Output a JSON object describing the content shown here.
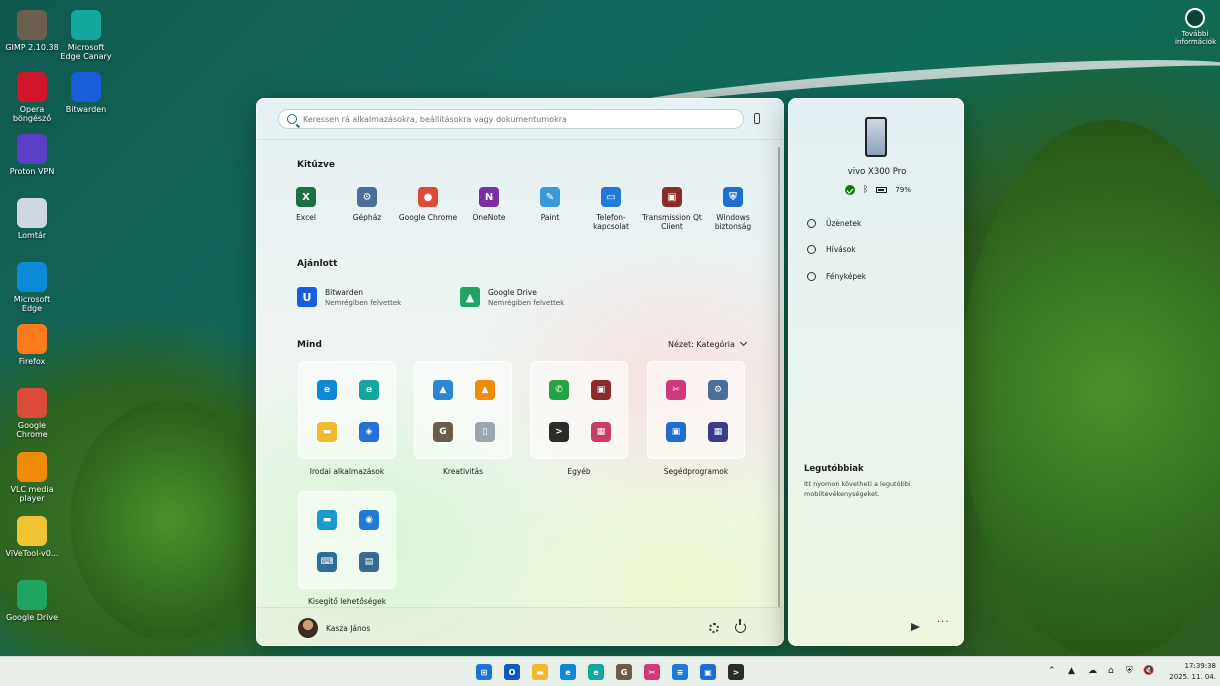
{
  "desktop": {
    "icons": [
      {
        "label": "GIMP 2.10.38",
        "name": "gimp-icon"
      },
      {
        "label": "Microsoft Edge Canary",
        "name": "edge-canary-icon"
      },
      {
        "label": "Opera böngésző",
        "name": "opera-icon"
      },
      {
        "label": "Bitwarden",
        "name": "bitwarden-icon"
      },
      {
        "label": "Proton VPN",
        "name": "proton-vpn-icon"
      },
      {
        "label": "Lomtár",
        "name": "recycle-bin-icon"
      },
      {
        "label": "Microsoft Edge",
        "name": "edge-icon"
      },
      {
        "label": "Firefox",
        "name": "firefox-icon"
      },
      {
        "label": "Google Chrome",
        "name": "chrome-icon"
      },
      {
        "label": "VLC media player",
        "name": "vlc-icon"
      },
      {
        "label": "ViVeTool-v0...",
        "name": "folder-icon"
      },
      {
        "label": "Google Drive",
        "name": "google-drive-icon"
      }
    ],
    "info": "További információk"
  },
  "start": {
    "search_placeholder": "Keressen rá alkalmazásokra, beállításokra vagy dokumentumokra",
    "pinned_title": "Kitűzve",
    "pinned": [
      {
        "label": "Excel",
        "name": "excel-icon",
        "color": "#1d7044",
        "glyph": "X"
      },
      {
        "label": "Gépház",
        "name": "settings-icon",
        "color": "#4a6f9a",
        "glyph": "⚙"
      },
      {
        "label": "Google Chrome",
        "name": "chrome-icon",
        "color": "#dd4b39",
        "glyph": "●"
      },
      {
        "label": "OneNote",
        "name": "onenote-icon",
        "color": "#7b2fa6",
        "glyph": "N"
      },
      {
        "label": "Paint",
        "name": "paint-icon",
        "color": "#3a9ad9",
        "glyph": "✎"
      },
      {
        "label": "Telefon-kapcsolat",
        "name": "phone-link-icon",
        "color": "#1f7ad8",
        "glyph": "▭"
      },
      {
        "label": "Transmission Qt Client",
        "name": "transmission-icon",
        "color": "#8b2b2b",
        "glyph": "▣"
      },
      {
        "label": "Windows biztonság",
        "name": "windows-security-icon",
        "color": "#1f6fd1",
        "glyph": "⛨"
      }
    ],
    "recommended_title": "Ajánlott",
    "recommended": [
      {
        "title": "Bitwarden",
        "subtitle": "Nemrégiben felvettek",
        "name": "bitwarden-icon",
        "color": "#175ddc",
        "glyph": "U"
      },
      {
        "title": "Google Drive",
        "subtitle": "Nemrégiben felvettek",
        "name": "google-drive-icon",
        "color": "#1fa463",
        "glyph": "▲"
      }
    ],
    "all_title": "Mind",
    "view_label": "Nézet: Kategória",
    "categories": [
      {
        "label": "Irodai alkalmazások",
        "apps": [
          {
            "name": "edge-icon",
            "color": "#0c8ad8",
            "glyph": "e"
          },
          {
            "name": "edge-canary-icon",
            "color": "#13a89e",
            "glyph": "e"
          },
          {
            "name": "file-explorer-icon",
            "color": "#f1b92e",
            "glyph": "▬"
          },
          {
            "name": "office-icon",
            "color": "#2a6fd6",
            "glyph": "◈"
          }
        ]
      },
      {
        "label": "Kreativitás",
        "apps": [
          {
            "name": "photos-icon",
            "color": "#2b86d8",
            "glyph": "▲"
          },
          {
            "name": "vlc-icon",
            "color": "#f08a0a",
            "glyph": "▲"
          },
          {
            "name": "gimp-icon",
            "color": "#6b5e4e",
            "glyph": "G"
          },
          {
            "name": "documents-icon",
            "color": "#9aa6b0",
            "glyph": "▯"
          }
        ]
      },
      {
        "label": "Egyéb",
        "apps": [
          {
            "name": "whatsapp-icon",
            "color": "#25a244",
            "glyph": "✆"
          },
          {
            "name": "transmission-icon",
            "color": "#8b2b2b",
            "glyph": "▣"
          },
          {
            "name": "terminal-icon",
            "color": "#2b2b2b",
            "glyph": ">"
          },
          {
            "name": "apps-group-icon",
            "color": "#c83c6a",
            "glyph": "▦"
          }
        ]
      },
      {
        "label": "Segédprogramok",
        "apps": [
          {
            "name": "snipping-tool-icon",
            "color": "#d13a7a",
            "glyph": "✂"
          },
          {
            "name": "settings-icon",
            "color": "#4a6f9a",
            "glyph": "⚙"
          },
          {
            "name": "microsoft-store-icon",
            "color": "#1d6ecf",
            "glyph": "▣"
          },
          {
            "name": "utilities-group-icon",
            "color": "#3b3b8a",
            "glyph": "▦"
          }
        ]
      },
      {
        "label": "Kisegítő lehetőségek",
        "apps": [
          {
            "name": "live-captions-icon",
            "color": "#1a9bd0",
            "glyph": "▬"
          },
          {
            "name": "voice-access-icon",
            "color": "#1f7ad8",
            "glyph": "◉"
          },
          {
            "name": "on-screen-keyboard-icon",
            "color": "#2e6f9a",
            "glyph": "⌨"
          },
          {
            "name": "narrator-icon",
            "color": "#3b6a8f",
            "glyph": "▤"
          }
        ]
      }
    ],
    "user_name": "Kasza János"
  },
  "phone": {
    "device_name": "vivo X300 Pro",
    "battery": "79%",
    "menu": [
      "Üzenetek",
      "Hívások",
      "Fényképek"
    ],
    "recent_title": "Legutóbbiak",
    "recent_desc": "Itt nyomon követheti a legutóbbi mobiltevékenységeket."
  },
  "taskbar": {
    "time": "17:39:38",
    "date": "2025. 11. 04.",
    "apps": [
      {
        "name": "start-icon",
        "color": "#1a73d6",
        "glyph": "⊞"
      },
      {
        "name": "outlook-icon",
        "color": "#0f5ab8",
        "glyph": "O"
      },
      {
        "name": "file-explorer-icon",
        "color": "#f1b92e",
        "glyph": "▬"
      },
      {
        "name": "edge-icon",
        "color": "#0c8ad8",
        "glyph": "e"
      },
      {
        "name": "edge-canary-icon",
        "color": "#13a89e",
        "glyph": "e"
      },
      {
        "name": "gimp-icon",
        "color": "#6b5e4e",
        "glyph": "G"
      },
      {
        "name": "snipping-tool-icon",
        "color": "#d13a7a",
        "glyph": "✂"
      },
      {
        "name": "notepad-icon",
        "color": "#1f7ad8",
        "glyph": "≡"
      },
      {
        "name": "microsoft-store-icon",
        "color": "#1d6ecf",
        "glyph": "▣"
      },
      {
        "name": "terminal-icon",
        "color": "#2b2b2b",
        "glyph": ">"
      }
    ]
  }
}
